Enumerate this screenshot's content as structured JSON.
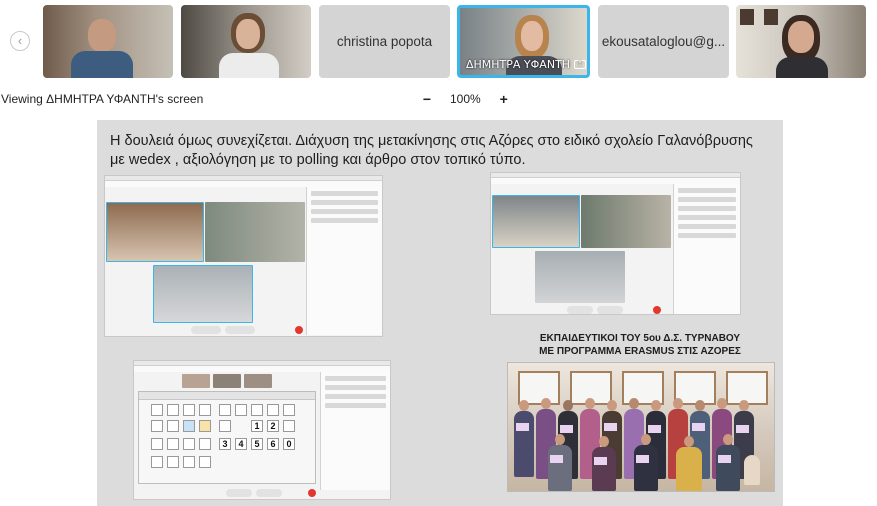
{
  "strip": {
    "participants": [
      {
        "type": "video",
        "label": ""
      },
      {
        "type": "video",
        "label": ""
      },
      {
        "type": "name",
        "label": "christina popota"
      },
      {
        "type": "video",
        "label": "ΔΗΜΗΤΡΑ ΥΦΑΝΤΗ",
        "active": true
      },
      {
        "type": "name",
        "label": "ekousataloglou@g..."
      },
      {
        "type": "video",
        "label": ""
      }
    ]
  },
  "toolbar": {
    "viewing_text": "Viewing ΔΗΜΗΤΡΑ ΥΦΑΝΤΗ's screen",
    "zoom_minus": "−",
    "zoom_level": "100%",
    "zoom_plus": "+"
  },
  "slide": {
    "title": "Η δουλειά όμως συνεχίζεται. Διάχυση της μετακίνησης στις Αζόρες στο ειδικό σχολείο Γαλανόβρυσης με wedex , αξιολόγηση με το polling και άρθρο στον τοπικό τύπο.",
    "caption_line1": "ΕΚΠΑΙΔΕΥΤΙΚΟΙ ΤΟΥ 5ου Δ.Σ. ΤΥΡΝΑΒΟΥ",
    "caption_line2": "ΜΕ ΠΡΟΓΡΑΜΜΑ ERASMUS ΣΤΙΣ ΑΖΟΡΕΣ",
    "board_cells": [
      "",
      "",
      "",
      "",
      "",
      "",
      "",
      "",
      "",
      "",
      "",
      "1",
      "2",
      "",
      "",
      "",
      "",
      "3",
      "4",
      "5",
      "6",
      "0",
      "",
      "",
      "",
      "",
      "",
      "",
      "",
      ""
    ]
  },
  "colors": {
    "active_border": "#3cb5e8",
    "end_call": "#e0382f",
    "shared_bg": "#dcdcdc"
  }
}
